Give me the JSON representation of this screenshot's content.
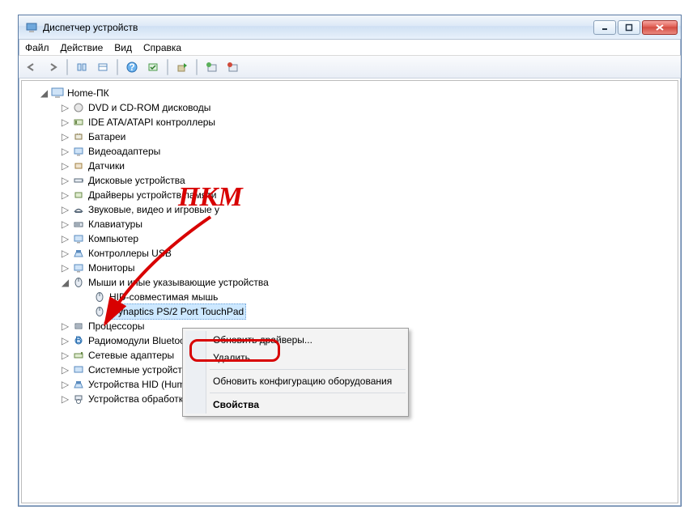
{
  "window": {
    "title": "Диспетчер устройств"
  },
  "menu": {
    "file": "Файл",
    "action": "Действие",
    "view": "Вид",
    "help": "Справка"
  },
  "root": "Home-ПК",
  "categories": [
    "DVD и CD-ROM дисководы",
    "IDE ATA/ATAPI контроллеры",
    "Батареи",
    "Видеоадаптеры",
    "Датчики",
    "Дисковые устройства",
    "Драйверы устройств памяти",
    "Звуковые, видео и игровые у",
    "Клавиатуры",
    "Компьютер",
    "Контроллеры USB",
    "Мониторы"
  ],
  "mice_cat": "Мыши и иные указывающие устройства",
  "mice_children": [
    "HID-совместимая мышь",
    "Synaptics PS/2 Port TouchPad"
  ],
  "categories_after": [
    "Процессоры",
    "Радиомодули Bluetoot",
    "Сетевые адаптеры",
    "Системные устройств",
    "Устройства HID (Hum",
    "Устройства обработки изображений"
  ],
  "context": {
    "update": "Обновить драйверы...",
    "delete": "Удалить",
    "refresh_hw": "Обновить конфигурацию оборудования",
    "props": "Свойства"
  },
  "annotation": "ПКМ"
}
